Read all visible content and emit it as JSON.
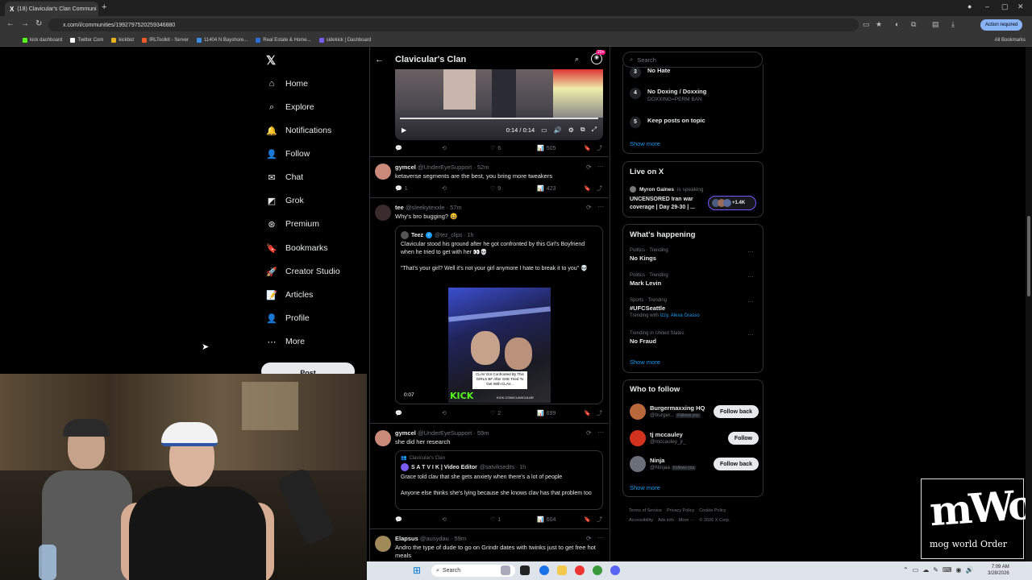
{
  "browser": {
    "tab_title": "(18) Clavicular's Clan Communi",
    "url": "x.com/i/communities/1992797520259346880",
    "action_required": "Action required",
    "all_bookmarks": "All Bookmarks",
    "bookmarks": [
      "kick dashboard",
      "Twitter Com",
      "kickbot",
      "IRLToolkit - Server",
      "11404 N Bayshore...",
      "Real Estate & Home...",
      "sidekick | Dashboard"
    ]
  },
  "nav": {
    "items": [
      {
        "label": "Home",
        "icon": "home-icon",
        "glyph": "⌂"
      },
      {
        "label": "Explore",
        "icon": "search-icon",
        "glyph": "⌕"
      },
      {
        "label": "Notifications",
        "icon": "bell-icon",
        "glyph": "🔔"
      },
      {
        "label": "Follow",
        "icon": "person-add-icon",
        "glyph": "👤"
      },
      {
        "label": "Chat",
        "icon": "mail-icon",
        "glyph": "✉"
      },
      {
        "label": "Grok",
        "icon": "grok-icon",
        "glyph": "◩"
      },
      {
        "label": "Premium",
        "icon": "x-premium-icon",
        "glyph": "⊛"
      },
      {
        "label": "Bookmarks",
        "icon": "bookmark-icon",
        "glyph": "🔖"
      },
      {
        "label": "Creator Studio",
        "icon": "rocket-icon",
        "glyph": "🚀"
      },
      {
        "label": "Articles",
        "icon": "article-icon",
        "glyph": "📝"
      },
      {
        "label": "Profile",
        "icon": "profile-icon",
        "glyph": "👤"
      },
      {
        "label": "More",
        "icon": "more-circle-icon",
        "glyph": "⋯"
      }
    ],
    "post_label": "Post"
  },
  "community": {
    "title": "Clavicular's Clan",
    "badge": "20+"
  },
  "top_video": {
    "time": "0:14 / 0:14",
    "replies": "",
    "reposts": "",
    "likes": "6",
    "views": "505"
  },
  "posts": [
    {
      "name": "gymcel",
      "handle": "@UnderEyeSupport · 52m",
      "text": "ketaverse segments are the best, you bring more tweakers",
      "replies": "1",
      "reposts": "",
      "likes": "9",
      "views": "423"
    },
    {
      "name": "tee",
      "handle": "@sleekytexxle · 57m",
      "text": "Why's bro bugging? 😆",
      "quote": {
        "name": "Teez",
        "handle": "@tez_clips · 1h",
        "text1": "Clavicular stood his ground after he got confronted by this Girl's Boyfriend when he tried to get with her 👀💀",
        "text2": "\"That's your girl? Well it's not your girl anymore I hate to break it to you\" 💀",
        "video_caption": "CLAV Got Confronted By This GIRLS BF After SHE Tried To Get With CLAV...",
        "video_brand": "KICK",
        "video_url": "KICK.COM/CLAVICULAR",
        "video_time": "0:07"
      },
      "replies": "",
      "reposts": "",
      "likes": "2",
      "views": "699"
    },
    {
      "name": "gymcel",
      "handle": "@UnderEyeSupport · 59m",
      "text": "she did her research",
      "quote": {
        "community": "Clavicular's Clan",
        "name": "S A T V I K | Video Editor",
        "handle": "@satviksedits · 1h",
        "text1": "Grace told clav that she gets anxiety when there's a lot of people",
        "text2": "Anyone else thinks she's lying because she knows clav has that problem too"
      },
      "replies": "",
      "reposts": "",
      "likes": "1",
      "views": "604"
    },
    {
      "name": "Elapsus",
      "handle": "@ausydau · 59m",
      "text": "Andro the type of dude to go on Grindr dates with twinks just to get free hot meals"
    }
  ],
  "right": {
    "search_placeholder": "Search",
    "rules": [
      {
        "num": "3",
        "title": "No Hate",
        "sub": ""
      },
      {
        "num": "4",
        "title": "No Doxing / Doxxing",
        "sub": "DOXXING=PERM BAN"
      },
      {
        "num": "5",
        "title": "Keep posts on topic",
        "sub": ""
      }
    ],
    "show_more": "Show more",
    "live": {
      "title": "Live on X",
      "speaker": "Myron Gaines",
      "speaking": "is speaking",
      "space_title": "UNCENSORED Iran war coverage | Day 29-30 | ...",
      "count": "+1.4K"
    },
    "happening": {
      "title": "What's happening",
      "trends": [
        {
          "cat": "Politics · Trending",
          "name": "No Kings",
          "with": "",
          "with_names": ""
        },
        {
          "cat": "Politics · Trending",
          "name": "Mark Levin",
          "with": "",
          "with_names": ""
        },
        {
          "cat": "Sports · Trending",
          "name": "#UFCSeattle",
          "with": "Trending with",
          "with_names": "Izzy, Alexa Grasso"
        },
        {
          "cat": "Trending in United States",
          "name": "No Fraud",
          "with": "",
          "with_names": ""
        }
      ]
    },
    "who_to_follow": {
      "title": "Who to follow",
      "accounts": [
        {
          "name": "Burgermaxxing HQ",
          "handle": "@burger...",
          "follows_you": "Follows you",
          "button": "Follow back",
          "color": "#b8683a"
        },
        {
          "name": "tj mccauley",
          "handle": "@mccauley_jr_",
          "follows_you": "",
          "button": "Follow",
          "color": "#d3321f"
        },
        {
          "name": "Ninja",
          "handle": "@Ninjaa",
          "follows_you": "Follows you",
          "button": "Follow back",
          "color": "#6b6f7a"
        }
      ]
    },
    "footer": [
      "Terms of Service",
      "Privacy Policy",
      "Cookie Policy",
      "Accessibility",
      "Ads info",
      "More ···",
      "© 2026 X Corp."
    ]
  },
  "watermark": {
    "big": "mWo",
    "small": "mog world Order"
  },
  "taskbar": {
    "search": "Search",
    "time": "7:09 AM",
    "date": "3/28/2026"
  }
}
